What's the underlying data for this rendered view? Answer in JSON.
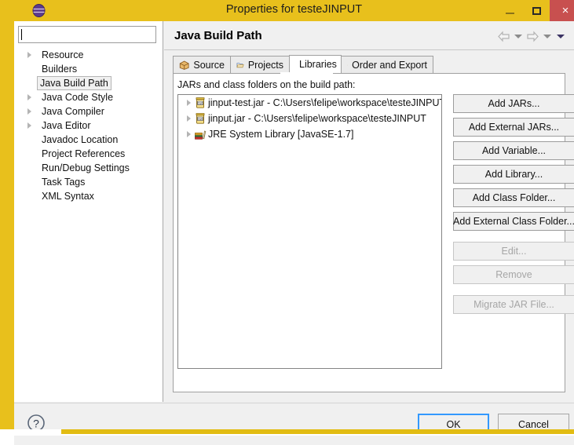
{
  "window": {
    "title": "Properties for testeJINPUT",
    "app_icon": "eclipse-icon",
    "minimize_label": "–",
    "maximize_label": "□",
    "close_label": "×",
    "frame_color": "#e8c01c",
    "close_color": "#c8504f"
  },
  "sidebar": {
    "filter": {
      "value": "",
      "placeholder": ""
    },
    "items": [
      {
        "label": "Resource",
        "expandable": true,
        "selected": false
      },
      {
        "label": "Builders",
        "expandable": false,
        "selected": false
      },
      {
        "label": "Java Build Path",
        "expandable": false,
        "selected": true
      },
      {
        "label": "Java Code Style",
        "expandable": true,
        "selected": false
      },
      {
        "label": "Java Compiler",
        "expandable": true,
        "selected": false
      },
      {
        "label": "Java Editor",
        "expandable": true,
        "selected": false
      },
      {
        "label": "Javadoc Location",
        "expandable": false,
        "selected": false
      },
      {
        "label": "Project References",
        "expandable": false,
        "selected": false
      },
      {
        "label": "Run/Debug Settings",
        "expandable": false,
        "selected": false
      },
      {
        "label": "Task Tags",
        "expandable": false,
        "selected": false
      },
      {
        "label": "XML Syntax",
        "expandable": false,
        "selected": false
      }
    ]
  },
  "page": {
    "title": "Java Build Path",
    "nav": {
      "back_icon": "back-arrow-icon",
      "back_menu_icon": "chevron-down-icon",
      "forward_icon": "forward-arrow-icon",
      "forward_menu_icon": "chevron-down-icon",
      "menu_icon": "chevron-down-icon"
    }
  },
  "tabs": [
    {
      "label": "Source",
      "icon": "package-icon",
      "active": false
    },
    {
      "label": "Projects",
      "icon": "folder-open-icon",
      "active": false
    },
    {
      "label": "Libraries",
      "icon": "books-icon",
      "active": true
    },
    {
      "label": "Order and Export",
      "icon": "order-export-icon",
      "active": false
    }
  ],
  "libraries": {
    "caption": "JARs and class folders on the build path:",
    "entries": [
      {
        "label": "jinput-test.jar - C:\\Users\\felipe\\workspace\\testeJINPUT",
        "icon": "jar-icon",
        "expandable": true
      },
      {
        "label": "jinput.jar - C:\\Users\\felipe\\workspace\\testeJINPUT",
        "icon": "jar-icon",
        "expandable": true
      },
      {
        "label": "JRE System Library [JavaSE-1.7]",
        "icon": "books-icon",
        "expandable": true
      }
    ],
    "buttons": [
      {
        "label": "Add JARs...",
        "enabled": true,
        "gap_above": false
      },
      {
        "label": "Add External JARs...",
        "enabled": true,
        "gap_above": false
      },
      {
        "label": "Add Variable...",
        "enabled": true,
        "gap_above": false
      },
      {
        "label": "Add Library...",
        "enabled": true,
        "gap_above": false
      },
      {
        "label": "Add Class Folder...",
        "enabled": true,
        "gap_above": false
      },
      {
        "label": "Add External Class Folder...",
        "enabled": true,
        "gap_above": false
      },
      {
        "label": "Edit...",
        "enabled": false,
        "gap_above": true
      },
      {
        "label": "Remove",
        "enabled": false,
        "gap_above": false
      },
      {
        "label": "Migrate JAR File...",
        "enabled": false,
        "gap_above": true
      }
    ]
  },
  "footer": {
    "help_icon": "help-icon",
    "ok_label": "OK",
    "cancel_label": "Cancel"
  }
}
